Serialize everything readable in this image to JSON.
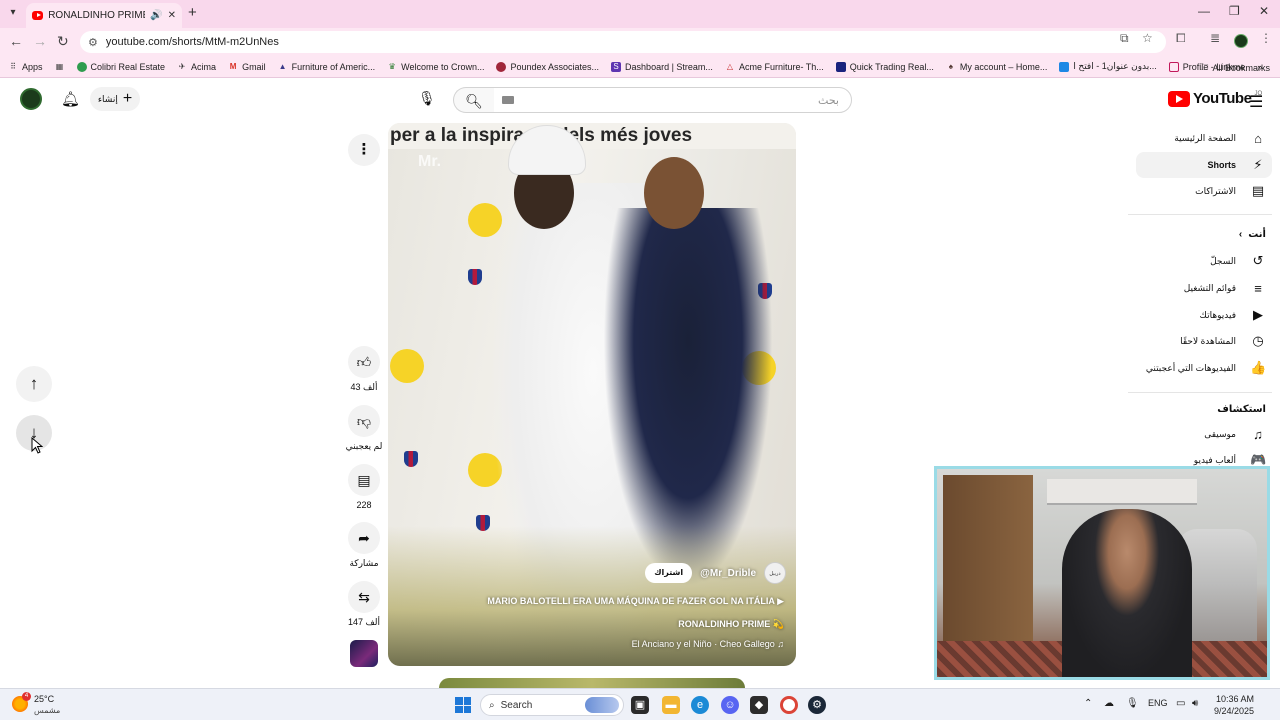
{
  "browser": {
    "tab_title": "RONALDINHO PRIME 💫 -",
    "url": "youtube.com/shorts/MtM-m2UnNes",
    "bookmarks": [
      {
        "label": "Apps",
        "color": "#4285f4"
      },
      {
        "label": "Colibri Real Estate",
        "color": "#2e9c4e"
      },
      {
        "label": "Acima",
        "color": "#333333"
      },
      {
        "label": "Gmail",
        "color": "#d93025"
      },
      {
        "label": "Furniture of Americ...",
        "color": "#3b3b8a"
      },
      {
        "label": "Welcome to Crown...",
        "color": "#2e7d32"
      },
      {
        "label": "Poundex Associates...",
        "color": "#a0263a"
      },
      {
        "label": "Dashboard | Stream...",
        "color": "#5e35b1"
      },
      {
        "label": "Acme Furniture- Th...",
        "color": "#c62828"
      },
      {
        "label": "Quick Trading Real...",
        "color": "#1a237e"
      },
      {
        "label": "My account – Home...",
        "color": "#4e342e"
      },
      {
        "label": "بدون عنوان1 - افتح ا...",
        "color": "#1e88e5"
      },
      {
        "label": "Profile - Linkme",
        "color": "#c2185b"
      }
    ],
    "all_bookmarks": "All Bookmarks"
  },
  "youtube": {
    "logo_text": "YouTube",
    "logo_sup": "JO",
    "search_placeholder": "بحث",
    "create_label": "إنشاء",
    "guide": {
      "items": [
        {
          "label": "الصفحة الرئيسية",
          "icon": "home-icon",
          "glyph": "⌂"
        },
        {
          "label": "Shorts",
          "icon": "shorts-icon",
          "glyph": "⚡",
          "active": true
        },
        {
          "label": "الاشتراكات",
          "icon": "subscriptions-icon",
          "glyph": "▤"
        }
      ],
      "you_header": "أنت",
      "you_items": [
        {
          "label": "السجلّ",
          "icon": "history-icon",
          "glyph": "↺"
        },
        {
          "label": "قوائم التشغيل",
          "icon": "playlists-icon",
          "glyph": "≡"
        },
        {
          "label": "فيديوهاتك",
          "icon": "your-videos-icon",
          "glyph": "▶"
        },
        {
          "label": "المشاهدة لاحقًا",
          "icon": "watch-later-icon",
          "glyph": "◷"
        },
        {
          "label": "الفيديوهات التي أعجبتني",
          "icon": "liked-videos-icon",
          "glyph": "👍"
        }
      ],
      "explore_header": "استكشاف",
      "explore_items": [
        {
          "label": "موسيقى",
          "icon": "music-icon",
          "glyph": "♫"
        },
        {
          "label": "ألعاب فيديو",
          "icon": "gaming-icon",
          "glyph": "🎮"
        }
      ]
    },
    "short": {
      "channel": "@Mr_Drible",
      "subscribe_label": "اشتراك",
      "channel_avatar_text": "دريبل",
      "overlay_title": "MARIO BALOTELLI ERA UMA MÁQUINA DE FAZER GOL NA ITÁLIA",
      "title": "RONALDINHO PRIME 💫",
      "sound": "El Anciano y el Niño · Cheo Gallego",
      "watermark": "Mr.",
      "banner_text": "per a la inspiració dels més joves"
    },
    "actions": {
      "like_count": "43 ألف",
      "dislike_label": "لم يعجبني",
      "comment_count": "228",
      "share_label": "مشاركة",
      "remix_count": "147 ألف"
    }
  },
  "taskbar": {
    "weather_temp": "25°C",
    "weather_desc": "مشمس",
    "weather_badge": "4",
    "search_label": "Search",
    "lang": "ENG",
    "time": "10:36 AM",
    "date": "9/24/2025"
  }
}
